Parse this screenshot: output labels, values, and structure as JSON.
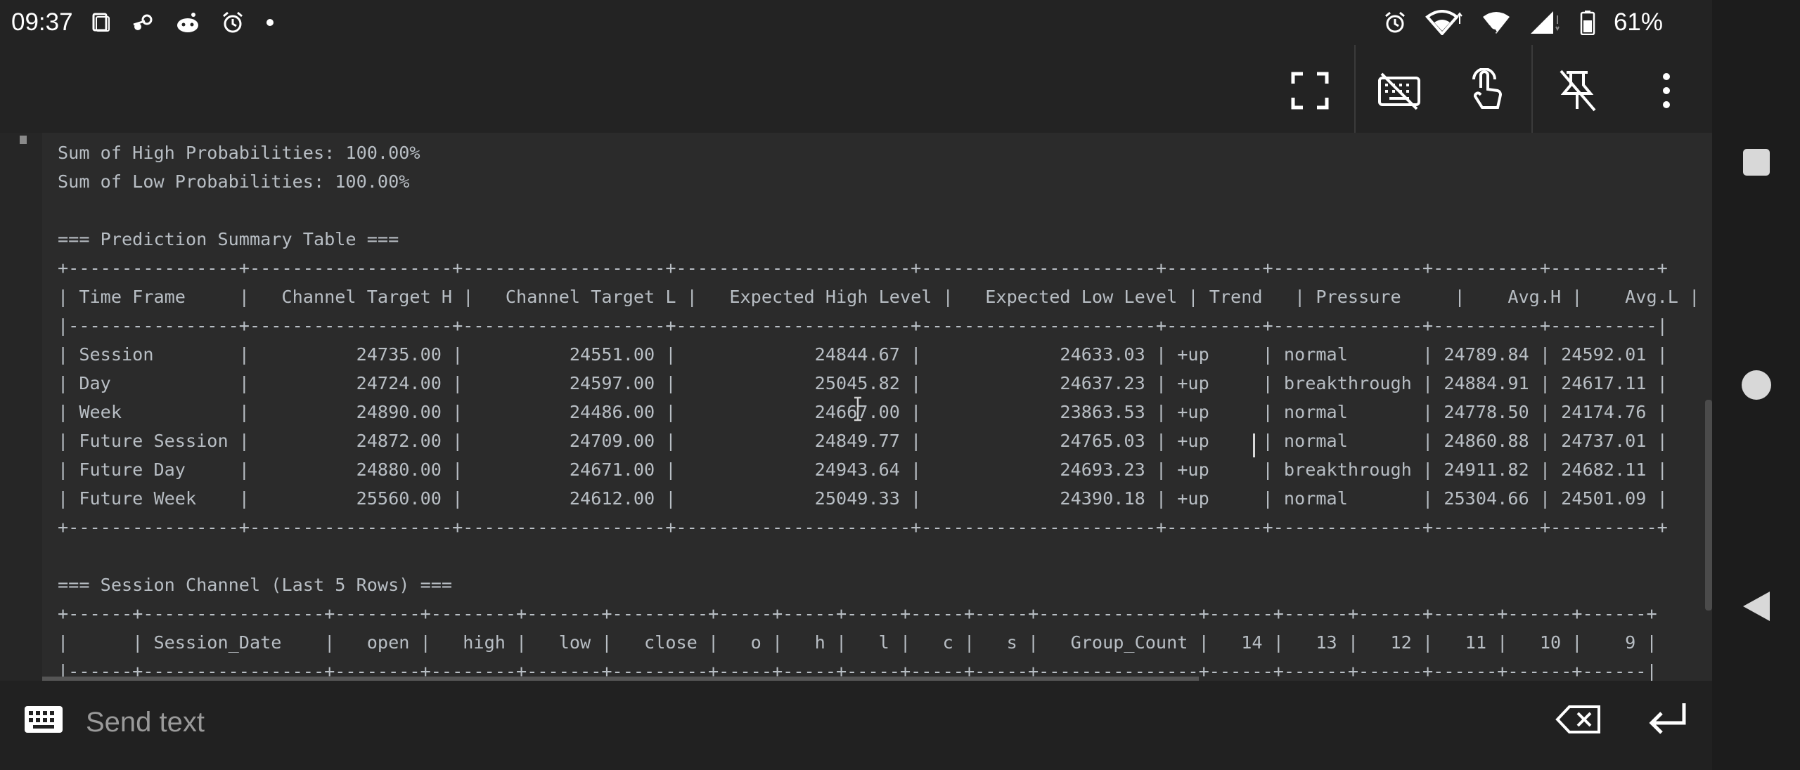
{
  "status_bar": {
    "time": "09:37",
    "battery": "61%",
    "left_icons": [
      "screenshot-icon",
      "steam-icon",
      "reddit-icon",
      "alarm-icon",
      "notification-dot-icon"
    ],
    "right_icons": [
      "alarm-icon",
      "wifi-icon",
      "wifi-call-icon",
      "signal-icon",
      "battery-icon"
    ]
  },
  "toolbar": {
    "buttons": [
      "fullscreen-icon",
      "keyboard-off-icon",
      "touch-icon",
      "unpin-icon",
      "more-vertical-icon"
    ]
  },
  "console": {
    "lines": [
      "Sum of High Probabilities: 100.00%",
      "Sum of Low Probabilities: 100.00%",
      "",
      "=== Prediction Summary Table ===",
      "+----------------+-------------------+-------------------+----------------------+----------------------+---------+--------------+----------+----------+",
      "| Time Frame     |   Channel Target H |   Channel Target L |   Expected High Level |   Expected Low Level | Trend   | Pressure     |    Avg.H |    Avg.L |",
      "|----------------+-------------------+-------------------+----------------------+----------------------+---------+--------------+----------+----------|",
      "| Session        |          24735.00 |          24551.00 |             24844.67 |             24633.03 | +up     | normal       | 24789.84 | 24592.01 |",
      "| Day            |          24724.00 |          24597.00 |             25045.82 |             24637.23 | +up     | breakthrough | 24884.91 | 24617.11 |",
      "| Week           |          24890.00 |          24486.00 |             24667.00 |             23863.53 | +up     | normal       | 24778.50 | 24174.76 |",
      "| Future Session |          24872.00 |          24709.00 |             24849.77 |             24765.03 | +up     | normal       | 24860.88 | 24737.01 |",
      "| Future Day     |          24880.00 |          24671.00 |             24943.64 |             24693.23 | +up     | breakthrough | 24911.82 | 24682.11 |",
      "| Future Week    |          25560.00 |          24612.00 |             25049.33 |             24390.18 | +up     | normal       | 25304.66 | 24501.09 |",
      "+----------------+-------------------+-------------------+----------------------+----------------------+---------+--------------+----------+----------+",
      "",
      "=== Session Channel (Last 5 Rows) ===",
      "+------+-----------------+--------+--------+-------+---------+-----+-----+-----+-----+-----+---------------+------+------+------+------+------+------+",
      "|      | Session_Date    |   open |   high |   low |   close |   o |   h |   l |   c |   s |   Group_Count |   14 |   13 |   12 |   11 |   10 |    9 |",
      "|------+-----------------+--------+--------+-------+---------+-----+-----+-----+-----+-----+---------------+------+------+------+------+------+------|"
    ]
  },
  "input": {
    "placeholder": "Send text"
  },
  "nav": {
    "buttons": [
      "recents-square-icon",
      "home-circle-icon",
      "back-triangle-icon"
    ]
  }
}
